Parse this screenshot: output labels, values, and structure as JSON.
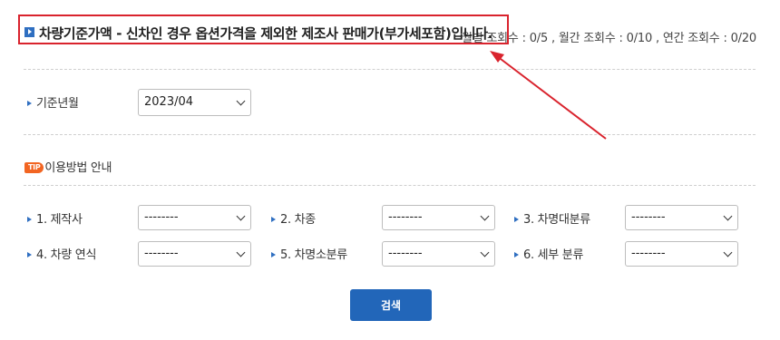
{
  "header": {
    "title": "차량기준가액 - 신차인 경우 옵션가격을 제외한 제조사 판매가(부가세포함)입니다.",
    "stats": "월별 조회수 : 0/5 , 월간 조회수 : 0/10 , 연간 조회수 : 0/20"
  },
  "base_month": {
    "label": "기준년월",
    "value": "2023/04"
  },
  "guide": {
    "badge": "TIP",
    "label": "이용방법 안내"
  },
  "filters": [
    {
      "label": "1. 제작사",
      "value": "--------"
    },
    {
      "label": "2. 차종",
      "value": "--------"
    },
    {
      "label": "3. 차명대분류",
      "value": "--------"
    },
    {
      "label": "4. 차량 연식",
      "value": "--------"
    },
    {
      "label": "5. 차명소분류",
      "value": "--------"
    },
    {
      "label": "6. 세부 분류",
      "value": "--------"
    }
  ],
  "search_button": "검색",
  "colors": {
    "accent": "#2266b9",
    "annotation": "#d9232d",
    "tip": "#f26522"
  }
}
